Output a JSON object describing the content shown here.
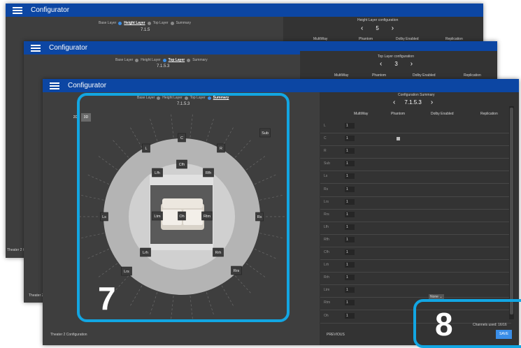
{
  "app_title": "Configurator",
  "windows": {
    "back": {
      "title": "Configurator",
      "crumbs": [
        "Base Layer",
        "Height Layer",
        "Top Layer",
        "Summary"
      ],
      "active_crumb": "Height Layer",
      "format": "7.1.5",
      "panel_title": "Height Layer configuration",
      "stepper_value": "5",
      "columns": [
        "MultiWay",
        "Phantom",
        "Dolby Enabled",
        "Replication"
      ],
      "footer": "Theater 2 Configuration"
    },
    "mid": {
      "title": "Configurator",
      "crumbs": [
        "Base Layer",
        "Height Layer",
        "Top Layer",
        "Summary"
      ],
      "active_crumb": "Top Layer",
      "format": "7.1.5.3",
      "panel_title": "Top Layer configuration",
      "stepper_value": "3",
      "columns": [
        "MultiWay",
        "Phantom",
        "Dolby Enabled",
        "Replication"
      ],
      "footer": "Theater 2 Configuration"
    },
    "front": {
      "title": "Configurator",
      "crumbs": [
        "Base Layer",
        "Height Layer",
        "Top Layer",
        "Summary"
      ],
      "active_crumb": "Summary",
      "format": "7.1.5.3",
      "view_toggle": [
        "2D",
        "3D"
      ],
      "panel_title": "Configuration Summary",
      "stepper_value": "7.1.5.3",
      "columns": [
        "MultiWay",
        "Phantom",
        "Dolby Enabled",
        "Replication"
      ],
      "rows": [
        {
          "name": "L",
          "multiway": "1",
          "phantom": false
        },
        {
          "name": "C",
          "multiway": "1",
          "phantom": true
        },
        {
          "name": "R",
          "multiway": "1",
          "phantom": false
        },
        {
          "name": "Sub",
          "multiway": "1",
          "phantom": false
        },
        {
          "name": "Ls",
          "multiway": "1",
          "phantom": false
        },
        {
          "name": "Rs",
          "multiway": "1",
          "phantom": false
        },
        {
          "name": "Lrs",
          "multiway": "1",
          "phantom": false
        },
        {
          "name": "Rrs",
          "multiway": "1",
          "phantom": false
        },
        {
          "name": "Lfh",
          "multiway": "1",
          "phantom": false
        },
        {
          "name": "Rfh",
          "multiway": "1",
          "phantom": false
        },
        {
          "name": "Cfh",
          "multiway": "1",
          "phantom": false
        },
        {
          "name": "Lrh",
          "multiway": "1",
          "phantom": false
        },
        {
          "name": "Rrh",
          "multiway": "1",
          "phantom": false
        },
        {
          "name": "Ltm",
          "multiway": "1",
          "phantom": false
        },
        {
          "name": "Rtm",
          "multiway": "1",
          "phantom": false
        },
        {
          "name": "Oh",
          "multiway": "1",
          "phantom": false
        }
      ],
      "dropdown": "None",
      "channels_label": "Channels used:",
      "channels_value": "16/16",
      "save_label": "SAVE",
      "previous_label": "PREVIOUS",
      "footer": "Theater 2 Configuration"
    }
  },
  "speakers": [
    "L",
    "C",
    "R",
    "Sub",
    "Lfh",
    "Cfh",
    "Rfh",
    "Ls",
    "Ltm",
    "Oh",
    "Rtm",
    "Rs",
    "Lrh",
    "Rrh",
    "Lrs",
    "Rrs"
  ],
  "annotations": {
    "left": "7",
    "right": "8"
  },
  "colors": {
    "titlebar": "#0c46a3",
    "highlight": "#12a6e3",
    "accent": "#3a8ee8"
  }
}
